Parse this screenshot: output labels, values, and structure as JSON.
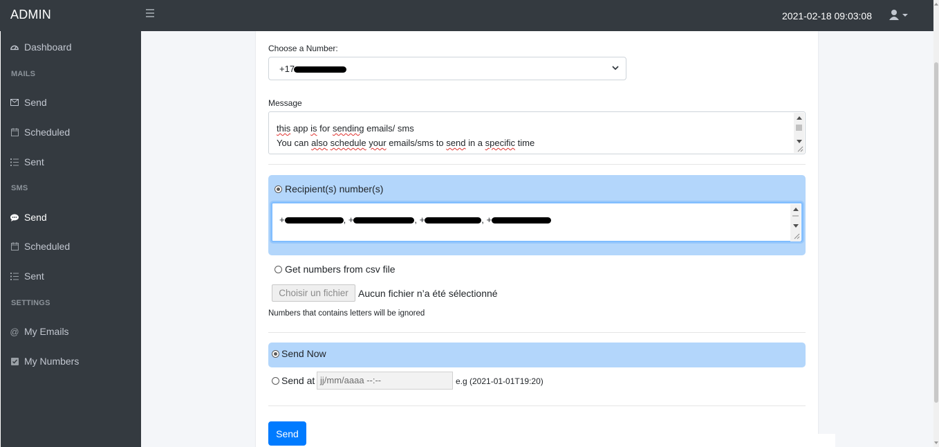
{
  "navbar": {
    "brand": "ADMIN",
    "datetime": "2021-02-18 09:03:08"
  },
  "sidebar": {
    "dashboard": "Dashboard",
    "mails_header": "MAILS",
    "mails_send": "Send",
    "mails_scheduled": "Scheduled",
    "mails_sent": "Sent",
    "sms_header": "SMS",
    "sms_send": "Send",
    "sms_scheduled": "Scheduled",
    "sms_sent": "Sent",
    "settings_header": "SETTINGS",
    "my_emails": "My Emails",
    "my_numbers": "My Numbers"
  },
  "form": {
    "number_label": "Choose a Number:",
    "number_value_visible": "+17",
    "message_label": "Message",
    "message_line1_words": [
      "this",
      " app ",
      "is",
      " for ",
      "sending",
      " emails/ sms"
    ],
    "message_line2_words": [
      "You can ",
      "also",
      " ",
      "schedule",
      " ",
      "your",
      " emails/sms to ",
      "send",
      " in a ",
      "specific",
      " time"
    ],
    "recipients_option": "Recipient(s) number(s)",
    "recipients_parts": [
      "+",
      ", +",
      ", +",
      ", +"
    ],
    "csv_option": "Get numbers from csv file",
    "file_button": "Choisir un fichier",
    "file_status": "Aucun fichier n’a été sélectionné",
    "csv_note": "Numbers that contains letters will be ignored",
    "send_now_option": "Send Now",
    "send_at_option": "Send at",
    "datetime_placeholder": "jj/mm/aaaa  --:--",
    "datetime_hint": "e.g (2021-01-01T19:20)",
    "submit": "Send"
  },
  "colors": {
    "navbar_bg": "#343a40",
    "panel_highlight": "#b3d6fb",
    "primary": "#007bff"
  }
}
